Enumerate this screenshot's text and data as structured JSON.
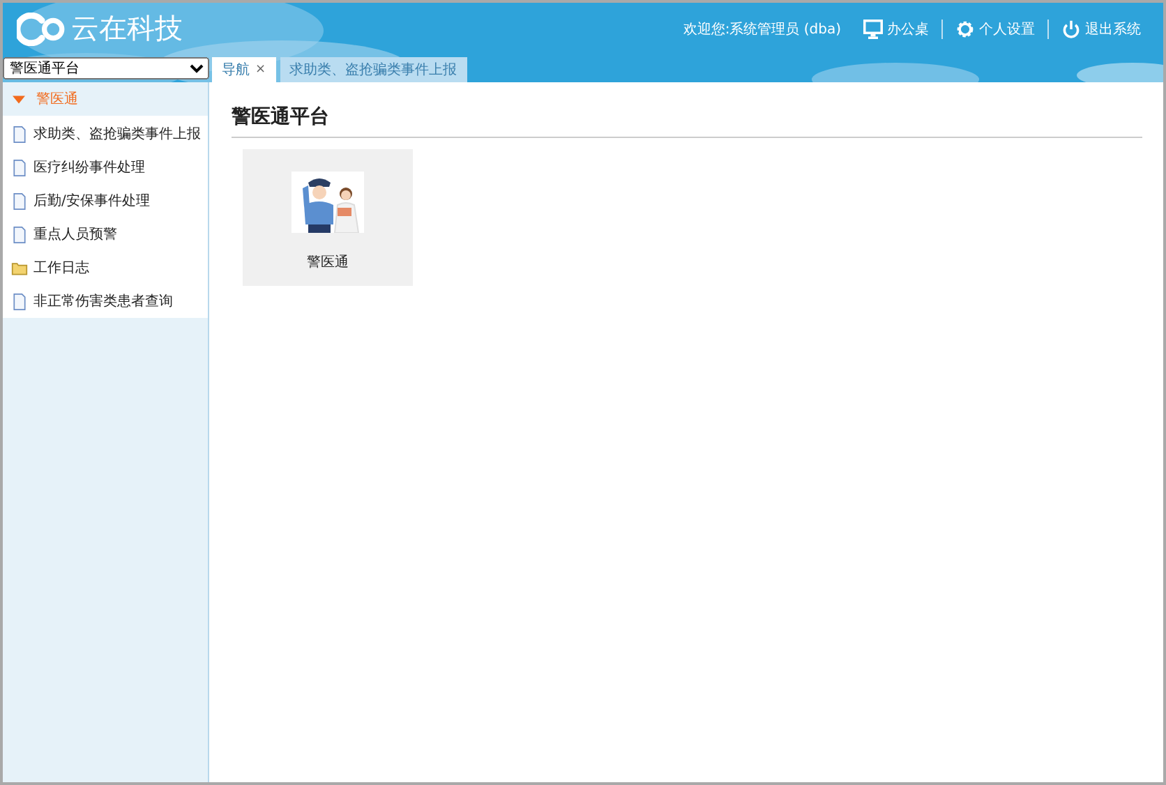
{
  "header": {
    "logo": "云在科技",
    "welcome": "欢迎您:系统管理员 (dba)",
    "links": [
      {
        "kind": "desktop",
        "label": "办公桌"
      },
      {
        "kind": "settings",
        "label": "个人设置"
      },
      {
        "kind": "power",
        "label": "退出系统"
      }
    ]
  },
  "platform_select": {
    "value": "警医通平台"
  },
  "tabs": [
    {
      "label": "导航",
      "close": "×",
      "selected": true
    },
    {
      "label": "求助类、盗抢骗类事件上报",
      "selected": false
    }
  ],
  "sidebar": {
    "group": {
      "label": "警医通",
      "expanded": true,
      "children": [
        {
          "kind": "page",
          "label": "求助类、盗抢骗类事件上报"
        },
        {
          "kind": "page",
          "label": "医疗纠纷事件处理"
        },
        {
          "kind": "page",
          "label": "后勤/安保事件处理"
        },
        {
          "kind": "page",
          "label": "重点人员预警"
        },
        {
          "kind": "folder",
          "label": "工作日志"
        },
        {
          "kind": "page",
          "label": "非正常伤害类患者查询"
        }
      ]
    }
  },
  "content": {
    "title": "警医通平台",
    "tiles": [
      {
        "kind": "picture",
        "label": "警医通"
      }
    ]
  }
}
